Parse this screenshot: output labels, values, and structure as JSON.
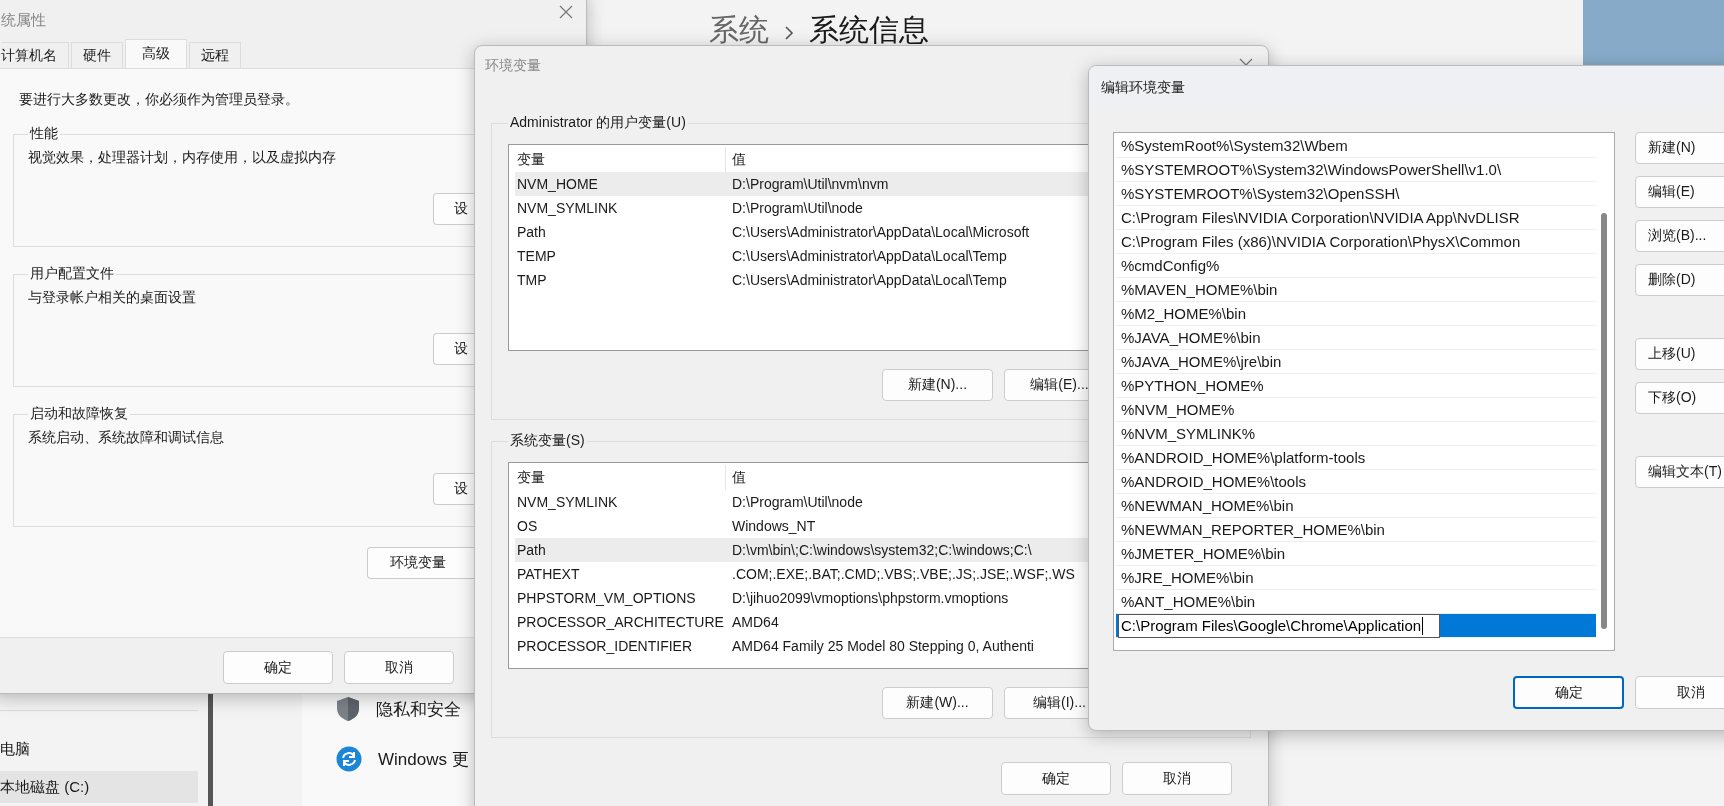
{
  "background_window": {
    "breadcrumb_parent": "系统",
    "breadcrumb_current": "系统信息",
    "nav_items": [
      {
        "label": "电脑",
        "selected": false
      },
      {
        "label": "本地磁盘 (C:)",
        "selected": true
      }
    ],
    "settings_items": [
      {
        "kind": "shield",
        "label": "隐私和安全"
      },
      {
        "kind": "update",
        "label": "Windows 更"
      }
    ]
  },
  "system_properties": {
    "title": "统属性",
    "tabs": [
      {
        "label": "计算机名",
        "selected": false
      },
      {
        "label": "硬件",
        "selected": false
      },
      {
        "label": "高级",
        "selected": true
      },
      {
        "label": "远程",
        "selected": false
      }
    ],
    "notice": "要进行大多数更改，你必须作为管理员登录。",
    "groups": [
      {
        "title": "性能",
        "description": "视觉效果，处理器计划，内存使用，以及虚拟内存",
        "button": "设"
      },
      {
        "title": "用户配置文件",
        "description": "与登录帐户相关的桌面设置",
        "button": "设"
      },
      {
        "title": "启动和故障恢复",
        "description": "系统启动、系统故障和调试信息",
        "button": "设"
      }
    ],
    "env_button": "环境变量",
    "buttons": [
      "确定",
      "取消"
    ]
  },
  "environment_variables": {
    "title": "环境变量",
    "user_group": {
      "title": "Administrator 的用户变量(U)",
      "columns": [
        "变量",
        "值"
      ],
      "rows": [
        {
          "name": "NVM_HOME",
          "value": "D:\\Program\\Util\\nvm\\nvm",
          "selected": true
        },
        {
          "name": "NVM_SYMLINK",
          "value": "D:\\Program\\Util\\node",
          "selected": false
        },
        {
          "name": "Path",
          "value": "C:\\Users\\Administrator\\AppData\\Local\\Microsoft",
          "selected": false
        },
        {
          "name": "TEMP",
          "value": "C:\\Users\\Administrator\\AppData\\Local\\Temp",
          "selected": false
        },
        {
          "name": "TMP",
          "value": "C:\\Users\\Administrator\\AppData\\Local\\Temp",
          "selected": false
        }
      ],
      "buttons": [
        "新建(N)...",
        "编辑(E)..."
      ]
    },
    "system_group": {
      "title": "系统变量(S)",
      "columns": [
        "变量",
        "值"
      ],
      "rows": [
        {
          "name": "NVM_SYMLINK",
          "value": "D:\\Program\\Util\\node",
          "selected": false
        },
        {
          "name": "OS",
          "value": "Windows_NT",
          "selected": false
        },
        {
          "name": "Path",
          "value": "D:\\vm\\bin\\;C:\\windows\\system32;C:\\windows;C:\\",
          "selected": true
        },
        {
          "name": "PATHEXT",
          "value": ".COM;.EXE;.BAT;.CMD;.VBS;.VBE;.JS;.JSE;.WSF;.WS",
          "selected": false
        },
        {
          "name": "PHPSTORM_VM_OPTIONS",
          "value": "D:\\jihuo2099\\vmoptions\\phpstorm.vmoptions",
          "selected": false
        },
        {
          "name": "PROCESSOR_ARCHITECTURE",
          "value": "AMD64",
          "selected": false
        },
        {
          "name": "PROCESSOR_IDENTIFIER",
          "value": "AMD64 Family 25 Model 80 Stepping 0, Authenti",
          "selected": false
        }
      ],
      "buttons": [
        "新建(W)...",
        "编辑(I)..."
      ]
    },
    "buttons": [
      "确定",
      "取消"
    ]
  },
  "edit_variable": {
    "title": "编辑环境变量",
    "entries": [
      {
        "text": "%SystemRoot%\\System32\\Wbem",
        "selected": false,
        "editing": false
      },
      {
        "text": "%SYSTEMROOT%\\System32\\WindowsPowerShell\\v1.0\\",
        "selected": false,
        "editing": false
      },
      {
        "text": "%SYSTEMROOT%\\System32\\OpenSSH\\",
        "selected": false,
        "editing": false
      },
      {
        "text": "C:\\Program Files\\NVIDIA Corporation\\NVIDIA App\\NvDLISR",
        "selected": false,
        "editing": false
      },
      {
        "text": "C:\\Program Files (x86)\\NVIDIA Corporation\\PhysX\\Common",
        "selected": false,
        "editing": false
      },
      {
        "text": "%cmdConfig%",
        "selected": false,
        "editing": false
      },
      {
        "text": "%MAVEN_HOME%\\bin",
        "selected": false,
        "editing": false
      },
      {
        "text": "%M2_HOME%\\bin",
        "selected": false,
        "editing": false
      },
      {
        "text": "%JAVA_HOME%\\bin",
        "selected": false,
        "editing": false
      },
      {
        "text": "%JAVA_HOME%\\jre\\bin",
        "selected": false,
        "editing": false
      },
      {
        "text": "%PYTHON_HOME%",
        "selected": false,
        "editing": false
      },
      {
        "text": "%NVM_HOME%",
        "selected": false,
        "editing": false
      },
      {
        "text": "%NVM_SYMLINK%",
        "selected": false,
        "editing": false
      },
      {
        "text": "%ANDROID_HOME%\\platform-tools",
        "selected": false,
        "editing": false
      },
      {
        "text": "%ANDROID_HOME%\\tools",
        "selected": false,
        "editing": false
      },
      {
        "text": "%NEWMAN_HOME%\\bin",
        "selected": false,
        "editing": false
      },
      {
        "text": "%NEWMAN_REPORTER_HOME%\\bin",
        "selected": false,
        "editing": false
      },
      {
        "text": "%JMETER_HOME%\\bin",
        "selected": false,
        "editing": false
      },
      {
        "text": "%JRE_HOME%\\bin",
        "selected": false,
        "editing": false
      },
      {
        "text": "%ANT_HOME%\\bin",
        "selected": false,
        "editing": false
      },
      {
        "text": "C:\\Program Files\\Google\\Chrome\\Application",
        "selected": true,
        "editing": true
      }
    ],
    "side_buttons": [
      {
        "label": "新建(N)",
        "kind": "action"
      },
      {
        "label": "编辑(E)",
        "kind": "action"
      },
      {
        "label": "浏览(B)...",
        "kind": "action"
      },
      {
        "label": "删除(D)",
        "kind": "action"
      },
      {
        "label": "上移(U)",
        "kind": "spaced"
      },
      {
        "label": "下移(O)",
        "kind": "action"
      },
      {
        "label": "编辑文本(T)",
        "kind": "spaced"
      }
    ],
    "buttons": [
      {
        "label": "确定",
        "default": true
      },
      {
        "label": "取消",
        "default": false
      }
    ]
  }
}
